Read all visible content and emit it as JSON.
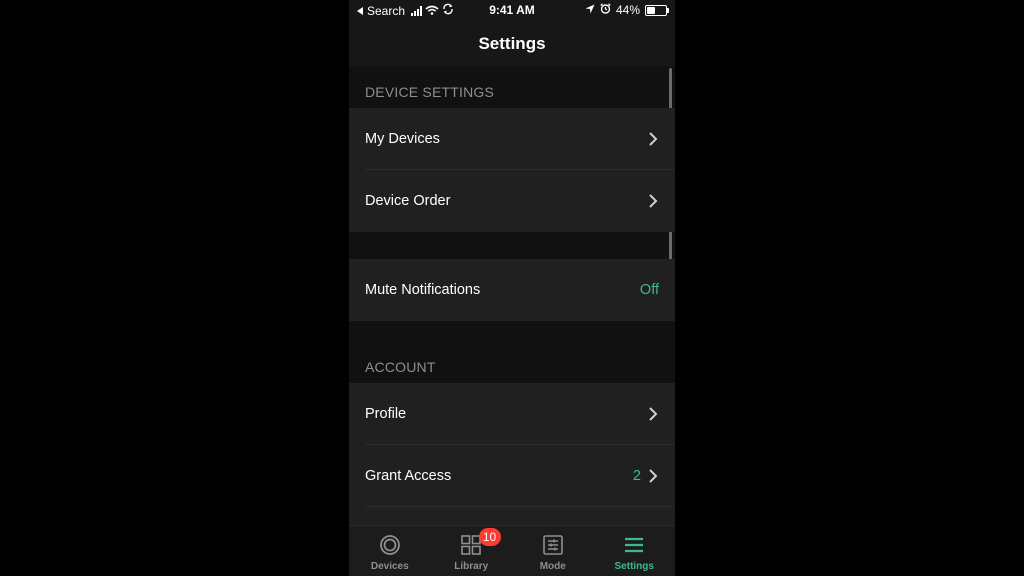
{
  "status_bar": {
    "back_app": "Search",
    "time": "9:41 AM",
    "battery": "44%",
    "battery_level": 0.44,
    "icons": [
      "back-arrow-icon",
      "signal-icon",
      "wifi-icon",
      "sync-icon",
      "location-icon",
      "alarm-icon",
      "battery-icon"
    ]
  },
  "header": {
    "title": "Settings"
  },
  "sections": {
    "device_settings": {
      "header": "DEVICE SETTINGS",
      "items": [
        {
          "label": "My Devices",
          "icon": "chevron-right-icon"
        },
        {
          "label": "Device Order",
          "icon": "chevron-right-icon"
        }
      ]
    },
    "notifications": {
      "items": [
        {
          "label": "Mute Notifications",
          "value": "Off"
        }
      ]
    },
    "account": {
      "header": "ACCOUNT",
      "items": [
        {
          "label": "Profile",
          "icon": "chevron-right-icon"
        },
        {
          "label": "Grant Access",
          "value": "2",
          "icon": "chevron-right-icon"
        }
      ]
    }
  },
  "tabbar": {
    "tabs": [
      {
        "label": "Devices",
        "icon": "devices-ring-icon",
        "active": false
      },
      {
        "label": "Library",
        "icon": "grid-icon",
        "badge": "10",
        "active": false
      },
      {
        "label": "Mode",
        "icon": "sliders-icon",
        "active": false
      },
      {
        "label": "Settings",
        "icon": "menu-icon",
        "active": true
      }
    ]
  },
  "colors": {
    "accent": "#3dba8c",
    "badge": "#ff3b30",
    "background": "#171717",
    "row_background": "#202020",
    "section_text": "#8e8e93"
  }
}
